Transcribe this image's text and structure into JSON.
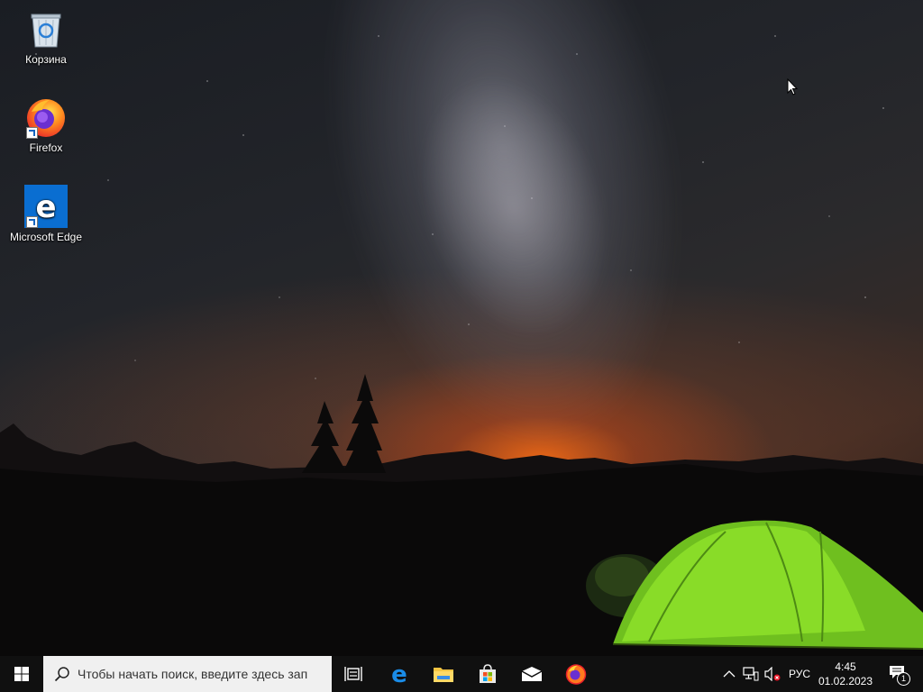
{
  "desktop": {
    "icons": [
      {
        "label": "Корзина",
        "icon": "recycle-bin-icon"
      },
      {
        "label": "Firefox",
        "icon": "firefox-icon"
      },
      {
        "label": "Microsoft Edge",
        "icon": "edge-icon"
      }
    ]
  },
  "taskbar": {
    "start_icon": "windows-logo-icon",
    "search_placeholder": "Чтобы начать поиск, введите здесь зап",
    "pinned": [
      {
        "name": "Task View",
        "icon": "task-view-icon"
      },
      {
        "name": "Microsoft Edge",
        "icon": "edge-icon"
      },
      {
        "name": "File Explorer",
        "icon": "folder-icon"
      },
      {
        "name": "Microsoft Store",
        "icon": "store-icon"
      },
      {
        "name": "Mail",
        "icon": "mail-icon"
      },
      {
        "name": "Firefox",
        "icon": "firefox-icon"
      }
    ],
    "tray": {
      "language": "РУС",
      "time": "4:45",
      "date": "01.02.2023",
      "notification_count": "1"
    }
  },
  "colors": {
    "taskbar_bg": "#101010",
    "search_bg": "#f0f0f0",
    "edge_blue": "#0a6ed1",
    "tent_green": "#7ed321"
  }
}
